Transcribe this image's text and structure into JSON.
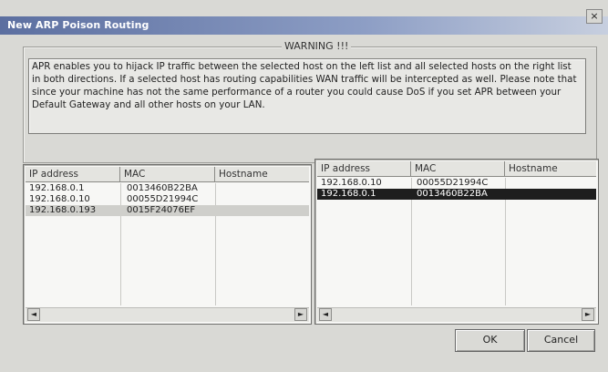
{
  "window": {
    "title": "New ARP Poison Routing",
    "close_glyph": "×"
  },
  "warning": {
    "legend": "WARNING !!!",
    "text": "APR enables you to hijack IP traffic between the selected host on the left list and all selected hosts on the right list in both directions. If a selected host has routing capabilities WAN traffic will be intercepted as well. Please note that since your machine has not the same performance of a router you could cause DoS if you set APR between your Default Gateway and all other hosts on your LAN."
  },
  "left_list": {
    "columns": [
      "IP address",
      "MAC",
      "Hostname"
    ],
    "rows": [
      {
        "ip": "192.168.0.1",
        "mac": "0013460B22BA",
        "hostname": ""
      },
      {
        "ip": "192.168.0.10",
        "mac": "00055D21994C",
        "hostname": ""
      },
      {
        "ip": "192.168.0.193",
        "mac": "0015F24076EF",
        "hostname": ""
      }
    ],
    "highlighted_row": 2
  },
  "right_list": {
    "columns": [
      "IP address",
      "MAC",
      "Hostname"
    ],
    "rows": [
      {
        "ip": "192.168.0.10",
        "mac": "00055D21994C",
        "hostname": ""
      },
      {
        "ip": "192.168.0.1",
        "mac": "0013460B22BA",
        "hostname": ""
      }
    ],
    "selected_row": 1
  },
  "scrollbar": {
    "left_arrow": "◄",
    "right_arrow": "►"
  },
  "buttons": {
    "ok": "OK",
    "cancel": "Cancel"
  }
}
